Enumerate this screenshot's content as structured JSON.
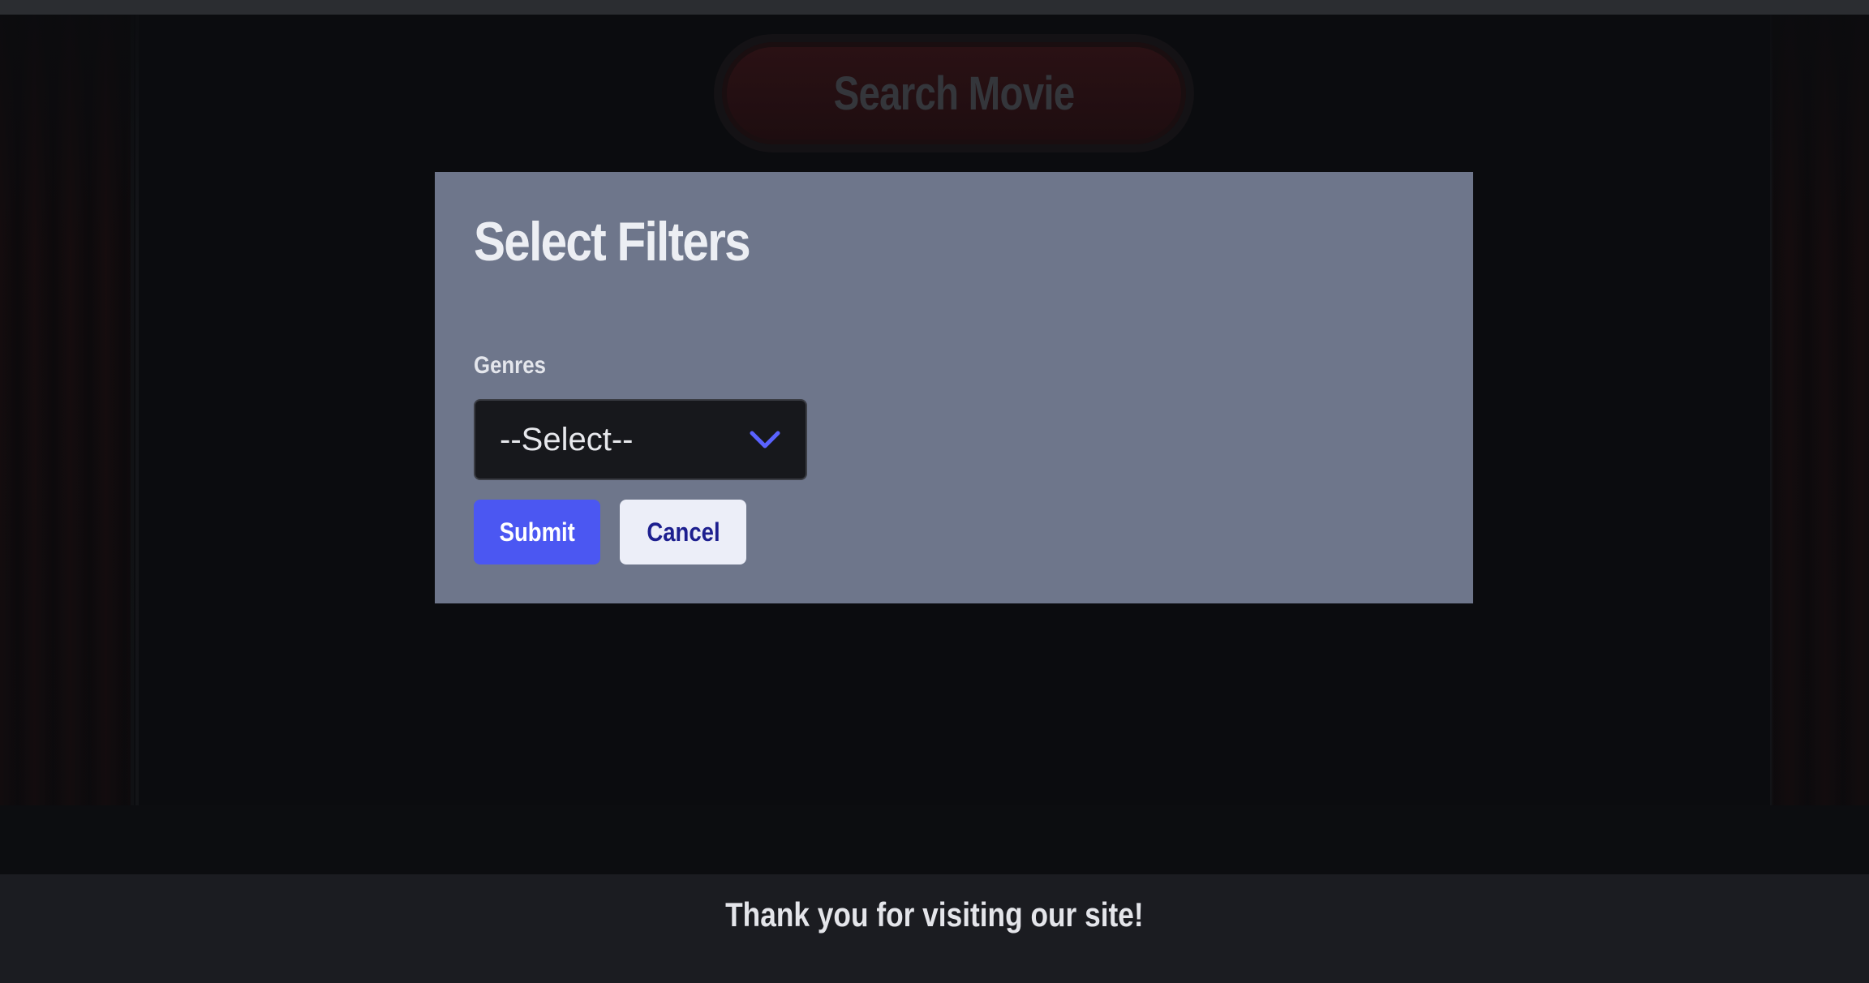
{
  "header": {
    "search_button_label": "Search Movie"
  },
  "filters_modal": {
    "title": "Select Filters",
    "genres_label": "Genres",
    "genres_selected": "--Select--",
    "submit_label": "Submit",
    "cancel_label": "Cancel"
  },
  "footer": {
    "message": "Thank you for visiting our site!"
  },
  "icons": {
    "select_arrow": "chevron-down-icon"
  },
  "colors": {
    "accent": "#4b57f2",
    "modal_background": "#6e768b",
    "cancel_text": "#1d1f8f"
  }
}
